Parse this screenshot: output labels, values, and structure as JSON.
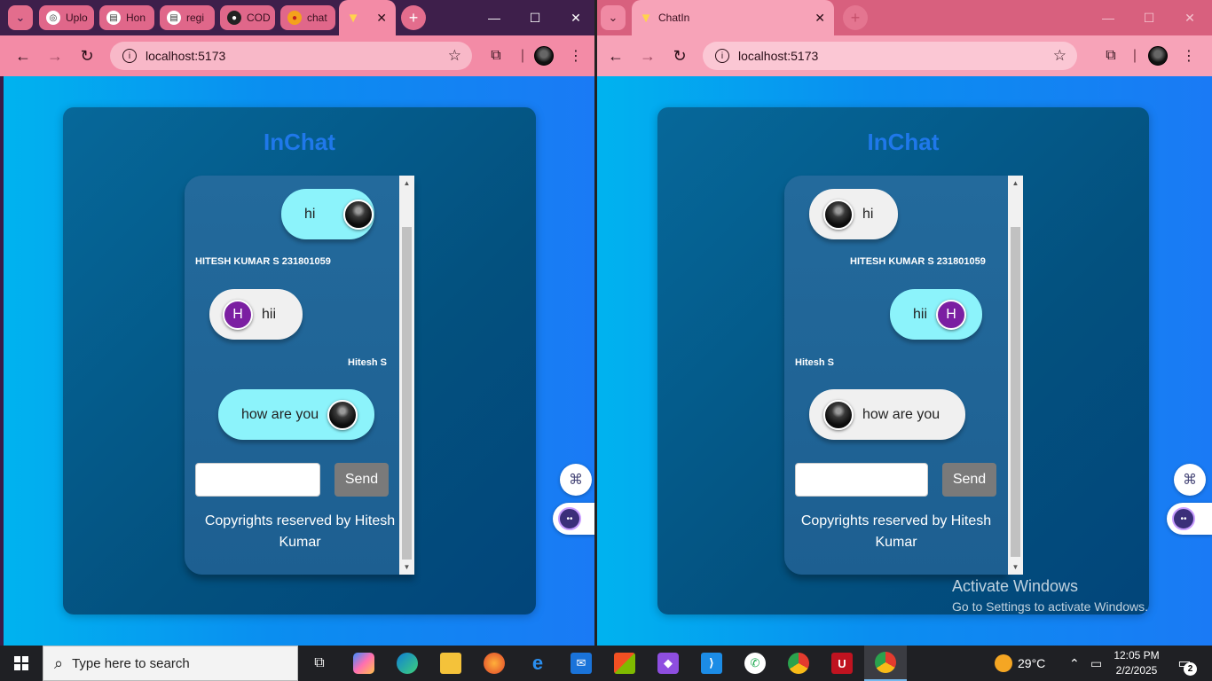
{
  "left_window": {
    "tabs": [
      {
        "label": "Uplo",
        "icon": "openai-icon"
      },
      {
        "label": "Hon",
        "icon": "page-icon"
      },
      {
        "label": "regi",
        "icon": "page-icon"
      },
      {
        "label": "COD",
        "icon": "github-icon"
      },
      {
        "label": "chat",
        "icon": "chat-icon"
      },
      {
        "label": "",
        "icon": "vite-icon"
      }
    ],
    "url": "localhost:5173"
  },
  "right_window": {
    "tabs": [
      {
        "label": "ChatIn",
        "icon": "vite-icon"
      }
    ],
    "url": "localhost:5173"
  },
  "app": {
    "title": "InChat",
    "send_label": "Send",
    "copyright": "Copyrights reserved by Hitesh Kumar"
  },
  "left_chat": {
    "messages": [
      {
        "text": "hi",
        "side": "own",
        "avatar": "photo"
      },
      {
        "sender": "HITESH KUMAR S 231801059"
      },
      {
        "text": "hii",
        "side": "other",
        "avatar": "H"
      },
      {
        "sender": "Hitesh S"
      },
      {
        "text": "how are you",
        "side": "own",
        "avatar": "photo"
      }
    ]
  },
  "right_chat": {
    "messages": [
      {
        "text": "hi",
        "side": "other",
        "avatar": "photo"
      },
      {
        "sender": "HITESH KUMAR S 231801059"
      },
      {
        "text": "hii",
        "side": "own",
        "avatar": "H"
      },
      {
        "sender": "Hitesh S"
      },
      {
        "text": "how are you",
        "side": "other",
        "avatar": "photo"
      }
    ]
  },
  "watermark": {
    "line1": "Activate Windows",
    "line2": "Go to Settings to activate Windows."
  },
  "taskbar": {
    "search_placeholder": "Type here to search",
    "weather": "29°C",
    "time": "12:05 PM",
    "date": "2/2/2025",
    "notifications": "2",
    "apps": [
      "task-view",
      "copilot",
      "edge",
      "file-explorer",
      "firefox",
      "internet-explorer",
      "mail",
      "store",
      "obsidian",
      "vscode",
      "whatsapp",
      "chrome",
      "app-red",
      "chrome-profile"
    ]
  },
  "colors": {
    "accent_title": "#1f78ea",
    "own_bubble": "#8cf3fb",
    "other_bubble": "#f0f0f0",
    "avatar_letter_bg": "#7b1fa2",
    "send_button": "#7a7a7a"
  }
}
